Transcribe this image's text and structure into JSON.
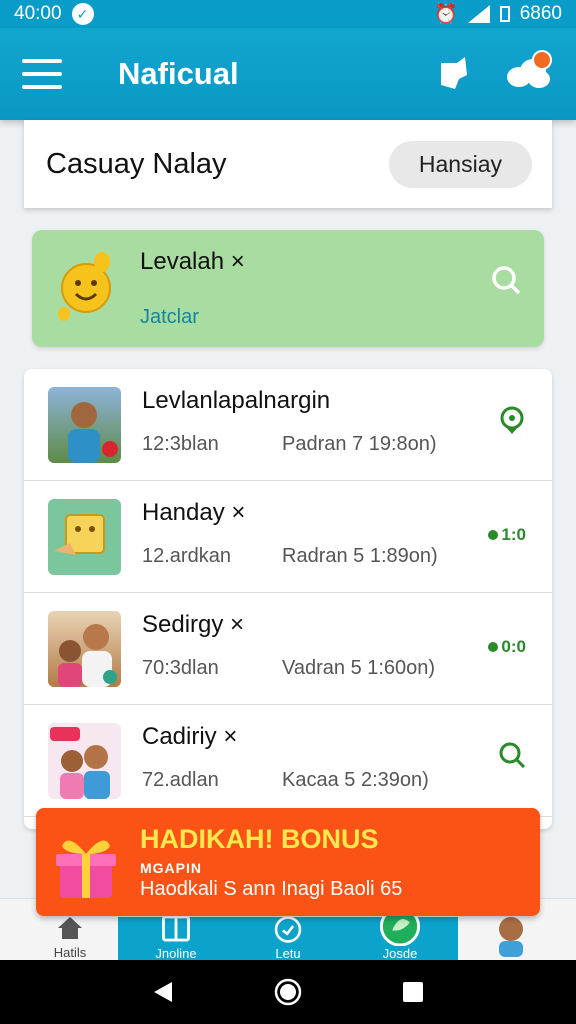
{
  "status_bar": {
    "time": "40:00",
    "battery_text": "6860"
  },
  "app_bar": {
    "title": "Naficual"
  },
  "header": {
    "title": "Casuay Nalay",
    "button_label": "Hansiay"
  },
  "level_card": {
    "title": "Levalah ×",
    "subtitle": "Jatclar"
  },
  "list": [
    {
      "title": "Levlanlapalnargin",
      "sub1": "12:3blan",
      "sub2": "Padran 7 19:8on)",
      "action": ""
    },
    {
      "title": "Handay ×",
      "sub1": "12.ardkan",
      "sub2": "Radran 5 1:89on)",
      "action": "1:0"
    },
    {
      "title": "Sedirgy ×",
      "sub1": "70:3dlan",
      "sub2": "Vadran 5 1:60on)",
      "action": "0:0"
    },
    {
      "title": "Cadiriy ×",
      "sub1": "72.adlan",
      "sub2": "Kacaa 5 2:39on)",
      "action": ""
    }
  ],
  "bonus": {
    "title": "HADIKAH! BONUS",
    "label": "MGAPIN",
    "text": "Haodkali S ann Inagi Baoli 65"
  },
  "bottom_nav": {
    "home": "Hatils",
    "tab2": "Jnoline",
    "tab3": "Letu",
    "tab4": "Josde"
  },
  "colors": {
    "primary": "#0a9cc8",
    "accent": "#fb5315",
    "level_bg": "#a9dca0",
    "action_green": "#2a8a2a"
  },
  "icons": [
    "menu-icon",
    "pin-icon",
    "cloud-icon",
    "search-icon",
    "location-icon",
    "gift-icon",
    "home-icon",
    "tablet-icon",
    "clock-icon",
    "leaf-icon",
    "back-icon",
    "home-circle-icon",
    "recents-icon"
  ]
}
